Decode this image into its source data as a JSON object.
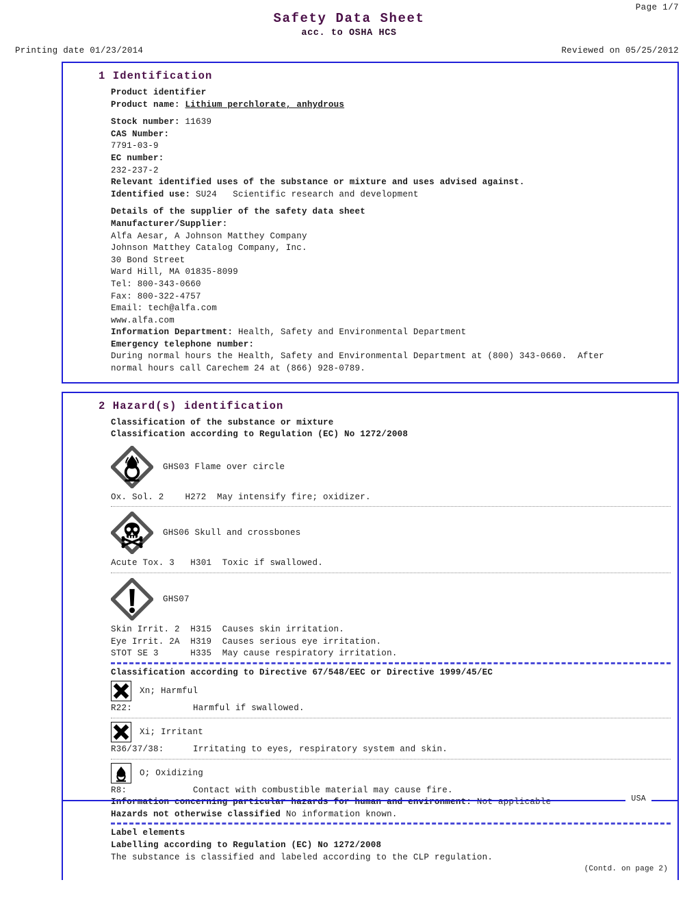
{
  "header": {
    "page_label": "Page 1/7",
    "title": "Safety Data Sheet",
    "subtitle": "acc. to OSHA HCS",
    "printing_date": "Printing date 01/23/2014",
    "reviewed_on": "Reviewed on 05/25/2012"
  },
  "colors": {
    "heading_purple": "#4b1048",
    "border_blue": "#1f1fd8",
    "dash_blue": "#4a4ad8"
  },
  "section1": {
    "heading": "1 Identification",
    "product_identifier_label": "Product identifier",
    "product_name_label": "Product name:",
    "product_name_value": "Lithium perchlorate, anhydrous",
    "stock_number_label": "Stock number:",
    "stock_number_value": "11639",
    "cas_number_label": "CAS Number:",
    "cas_number_value": "7791-03-9",
    "ec_number_label": "EC number:",
    "ec_number_value": "232-237-2",
    "relevant_uses": "Relevant identified uses of the substance or mixture and uses advised against.",
    "identified_use_label": "Identified use:",
    "identified_use_value": "SU24   Scientific research and development",
    "supplier_details_label": "Details of the supplier of the safety data sheet",
    "manufacturer_label": "Manufacturer/Supplier:",
    "address_lines": [
      "Alfa Aesar, A Johnson Matthey Company",
      "Johnson Matthey Catalog Company, Inc.",
      "30 Bond Street",
      "Ward Hill, MA 01835-8099",
      "Tel: 800-343-0660",
      "Fax: 800-322-4757",
      "Email: tech@alfa.com",
      "www.alfa.com"
    ],
    "info_dept_label": "Information Department:",
    "info_dept_value": "Health, Safety and Environmental Department",
    "emergency_label": "Emergency telephone number:",
    "emergency_line1": "During normal hours the Health, Safety and Environmental Department at (800) 343-0660.  After",
    "emergency_line2": "normal hours call Carechem 24 at (866) 928-0789."
  },
  "section2": {
    "heading": "2 Hazard(s) identification",
    "classification_label": "Classification of the substance or mixture",
    "classification_reg_label": "Classification according to Regulation (EC) No 1272/2008",
    "ghs_groups": [
      {
        "pictogram": "ghs03-flame-over-circle",
        "pictogram_label": "GHS03 Flame over circle",
        "statements": [
          {
            "class": "Ox. Sol. 2",
            "code": "H272",
            "text": "May intensify fire; oxidizer."
          }
        ]
      },
      {
        "pictogram": "ghs06-skull-and-crossbones",
        "pictogram_label": "GHS06 Skull and crossbones",
        "statements": [
          {
            "class": "Acute Tox. 3",
            "code": "H301",
            "text": "Toxic if swallowed."
          }
        ]
      },
      {
        "pictogram": "ghs07-exclamation-mark",
        "pictogram_label": "GHS07",
        "statements": [
          {
            "class": "Skin Irrit. 2",
            "code": "H315",
            "text": "Causes skin irritation."
          },
          {
            "class": "Eye Irrit. 2A",
            "code": "H319",
            "text": "Causes serious eye irritation."
          },
          {
            "class": "STOT SE 3",
            "code": "H335",
            "text": "May cause respiratory irritation."
          }
        ]
      }
    ],
    "statement_lines": [
      "Ox. Sol. 2    H272  May intensify fire; oxidizer.",
      "Acute Tox. 3   H301  Toxic if swallowed.",
      "Skin Irrit. 2  H315  Causes skin irritation.",
      "Eye Irrit. 2A  H319  Causes serious eye irritation.",
      "STOT SE 3      H335  May cause respiratory irritation."
    ],
    "directive_label": "Classification according to Directive 67/548/EEC or Directive 1999/45/EC",
    "eu_groups": [
      {
        "symbol": "xn-harmful-x-symbol",
        "symbol_label": "Xn; Harmful",
        "rcode": "R22:",
        "rtext": "Harmful if swallowed."
      },
      {
        "symbol": "xi-irritant-x-symbol",
        "symbol_label": "Xi; Irritant",
        "rcode": "R36/37/38:",
        "rtext": "Irritating to eyes, respiratory system and skin."
      },
      {
        "symbol": "o-oxidizing-flame-symbol",
        "symbol_label": "O; Oxidizing",
        "rcode": "R8:",
        "rtext": "Contact with combustible material may cause fire."
      }
    ],
    "info_hazards_label": "Information concerning particular hazards for human and environment:",
    "info_hazards_value": "Not applicable",
    "hnoc_label": "Hazards not otherwise classified",
    "hnoc_value": "No information known.",
    "label_elements_label": "Label elements",
    "labelling_reg_label": "Labelling according to Regulation (EC) No 1272/2008",
    "clp_text": "The substance is classified and labeled according to the CLP regulation."
  },
  "footer": {
    "contd": "(Contd. on page 2)",
    "country": "USA"
  }
}
